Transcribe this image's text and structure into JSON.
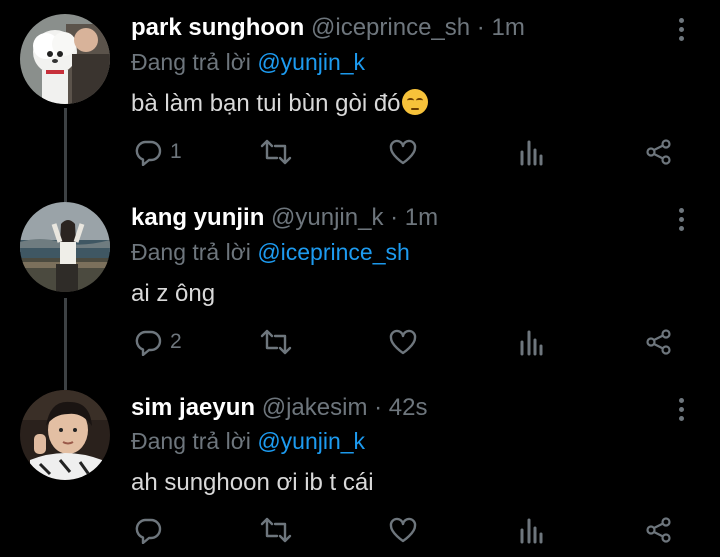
{
  "tweets": [
    {
      "name": "park sunghoon",
      "handle": "@iceprince_sh",
      "separator": "·",
      "time": "1m",
      "reply_prefix": "Đang trả lời",
      "reply_to": "@yunjin_k",
      "text": "bà làm bạn tui bùn gòi đó",
      "emoji": "pensive-face-emoji",
      "reply_count": "1",
      "retweet_count": "",
      "like_count": ""
    },
    {
      "name": "kang yunjin",
      "handle": "@yunjin_k",
      "separator": "·",
      "time": "1m",
      "reply_prefix": "Đang trả lời",
      "reply_to": "@iceprince_sh",
      "text": "ai z ông",
      "reply_count": "2",
      "retweet_count": "",
      "like_count": ""
    },
    {
      "name": "sim jaeyun",
      "handle": "@jakesim",
      "separator": "·",
      "time": "42s",
      "reply_prefix": "Đang trả lời",
      "reply_to": "@yunjin_k",
      "text": "ah sunghoon ơi ib t cái",
      "reply_count": "",
      "retweet_count": "",
      "like_count": ""
    }
  ],
  "icons": {
    "reply": "reply-icon",
    "retweet": "retweet-icon",
    "like": "heart-icon",
    "stats": "stats-icon",
    "share": "share-icon",
    "more": "more-vertical-icon"
  },
  "colors": {
    "background": "#000000",
    "name": "#ffffff",
    "muted": "#6e767d",
    "mention": "#1d9bf0",
    "thread_line": "#3d4144"
  }
}
